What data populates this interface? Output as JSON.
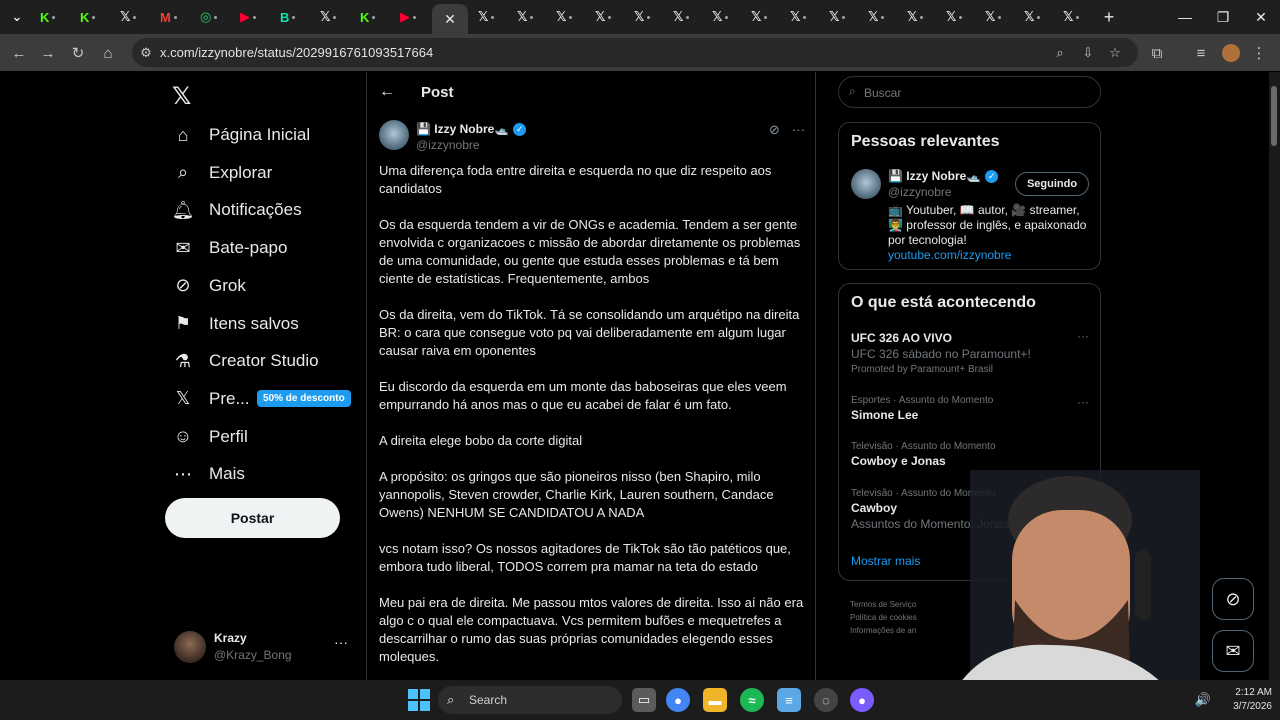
{
  "browser": {
    "url": "x.com/izzynobre/status/2029916761093517664",
    "tabs": [
      {
        "icon": "K",
        "color": "#53fc18"
      },
      {
        "icon": "K",
        "color": "#53fc18"
      },
      {
        "icon": "𝕏",
        "color": "#e7e9ea"
      },
      {
        "icon": "M",
        "color": "#ea4335"
      },
      {
        "icon": "◎",
        "color": "#25d366"
      },
      {
        "icon": "▶",
        "color": "#ff0033"
      },
      {
        "icon": "B",
        "color": "#14e3a8"
      },
      {
        "icon": "𝕏",
        "color": "#e7e9ea"
      },
      {
        "icon": "K",
        "color": "#53fc18"
      },
      {
        "icon": "▶",
        "color": "#ff0033"
      }
    ],
    "active_tab_close": "✕",
    "new_tab": "+"
  },
  "nav": {
    "items": [
      {
        "label": "Página Inicial",
        "icon": "home-icon"
      },
      {
        "label": "Explorar",
        "icon": "search-icon"
      },
      {
        "label": "Notificações",
        "icon": "bell-icon"
      },
      {
        "label": "Bate-papo",
        "icon": "mail-icon"
      },
      {
        "label": "Grok",
        "icon": "grok-icon"
      },
      {
        "label": "Itens salvos",
        "icon": "bookmark-icon"
      },
      {
        "label": "Creator Studio",
        "icon": "flask-icon"
      },
      {
        "label": "Pre...",
        "icon": "x-logo-icon"
      },
      {
        "label": "Perfil",
        "icon": "person-icon"
      },
      {
        "label": "Mais",
        "icon": "more-circle-icon"
      }
    ],
    "premium_badge": "50% de desconto",
    "post_button": "Postar",
    "account": {
      "name": "Krazy",
      "handle": "@Krazy_Bong"
    }
  },
  "main": {
    "title": "Post",
    "author": {
      "name": "💾 Izzy Nobre🛥️",
      "handle": "@izzynobre"
    },
    "paragraphs": [
      "Uma diferença foda entre direita e esquerda no que diz respeito aos candidatos",
      "Os da esquerda tendem a vir de ONGs e academia. Tendem a ser gente envolvida c organizacoes c missão de abordar diretamente os problemas de uma comunidade, ou gente que estuda esses problemas e tá bem ciente de estatísticas. Frequentemente, ambos",
      "Os da direita, vem do TikTok. Tá se consolidando um arquétipo na direita BR: o cara que consegue voto pq vai deliberadamente em algum lugar causar raiva em oponentes",
      "Eu discordo da esquerda em um monte das baboseiras que eles veem empurrando há anos mas o que eu acabei de falar é um fato.",
      "A direita elege bobo da corte digital",
      "A propósito: os gringos que são pioneiros nisso (ben Shapiro, milo yannopolis, Steven crowder, Charlie Kirk, Lauren southern, Candace Owens) NENHUM SE CANDIDATOU A NADA",
      "vcs notam isso? Os nossos agitadores de TikTok são tão patéticos que, embora tudo liberal, TODOS correm pra mamar na teta do estado",
      "Meu pai era de direita. Me passou mtos valores de direita. Isso aí não era algo c o qual ele compactuava. Vcs permitem bufões e mequetrefes a descarrilhar o rumo das suas próprias comunidades elegendo esses moleques."
    ]
  },
  "right": {
    "search_placeholder": "Buscar",
    "relevant": {
      "title": "Pessoas relevantes",
      "name": "💾 Izzy Nobre🛥️",
      "handle": "@izzynobre",
      "follow": "Seguindo",
      "bio": "📺 Youtuber, 📖 autor, 🎥 streamer, 👨‍🏫 professor de inglês, e apaixonado por tecnologia!",
      "link": "youtube.com/izzynobre"
    },
    "trends": {
      "title": "O que está acontecendo",
      "items": [
        {
          "meta": "",
          "title": "UFC 326 AO VIVO",
          "sub": "UFC 326 sábado no Paramount+!",
          "promo": "Promoted by Paramount+ Brasil"
        },
        {
          "meta": "Esportes · Assunto do Momento",
          "title": "Simone Lee",
          "sub": "",
          "promo": ""
        },
        {
          "meta": "Televisão · Assunto do Momento",
          "title": "Cowboy e Jonas",
          "sub": "",
          "promo": ""
        },
        {
          "meta": "Televisão · Assunto do Momento",
          "title": "Cawboy",
          "sub": "Assuntos do Momento: Jonas e Co",
          "promo": ""
        }
      ],
      "show_more": "Mostrar mais"
    },
    "footer": [
      "Termos de Serviço",
      "Política de cookies",
      "Informações de an"
    ]
  },
  "taskbar": {
    "search": "Search",
    "time": "2:12 AM",
    "date": "3/7/2026"
  }
}
